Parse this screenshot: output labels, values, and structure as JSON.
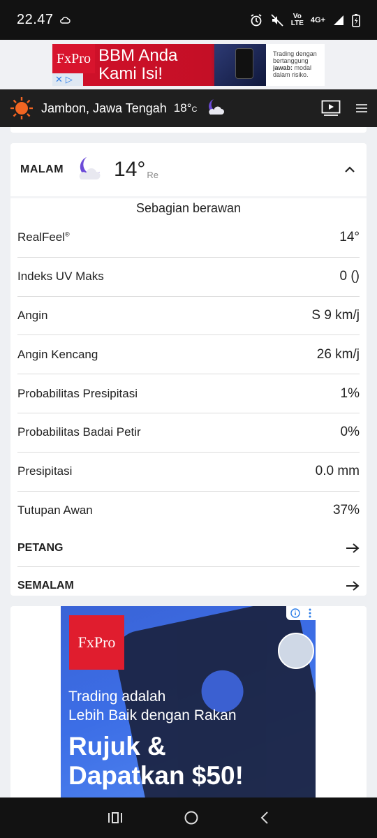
{
  "status_bar": {
    "time": "22.47",
    "network_top": "Vo",
    "network_bottom": "LTE",
    "network_type": "4G+",
    "icons": [
      "cloud-icon",
      "alarm-icon",
      "mute-icon",
      "signal-icon",
      "battery-icon"
    ]
  },
  "top_ad": {
    "logo": "FxPro",
    "headline_line1": "BBM Anda",
    "headline_line2": "Kami Isi!",
    "small_line1": "Trading dengan",
    "small_line2": "bertanggung",
    "small_line3": "jawab:",
    "small_line4": "modal",
    "small_line5": "dalam risiko."
  },
  "header": {
    "location": "Jambon, Jawa Tengah",
    "temp": "18°",
    "temp_unit": "C"
  },
  "night_card": {
    "period": "MALAM",
    "temp": "14°",
    "temp_unit": "Re",
    "phrase": "Sebagian berawan",
    "details": [
      {
        "label": "RealFeel",
        "value": "14°"
      },
      {
        "label": "Indeks UV Maks",
        "value": "0 ()"
      },
      {
        "label": "Angin",
        "value": "S 9 km/j"
      },
      {
        "label": "Angin Kencang",
        "value": "26 km/j"
      },
      {
        "label": "Probabilitas Presipitasi",
        "value": "1%"
      },
      {
        "label": "Probabilitas Badai Petir",
        "value": "0%"
      },
      {
        "label": "Presipitasi",
        "value": "0.0 mm"
      },
      {
        "label": "Tutupan Awan",
        "value": "37%"
      }
    ],
    "links": [
      {
        "label": "PETANG"
      },
      {
        "label": "SEMALAM"
      }
    ]
  },
  "bottom_ad": {
    "logo": "FxPro",
    "line1": "Trading adalah",
    "line2": "Lebih Baik dengan Rakan",
    "line3": "Rujuk &",
    "line4": "Dapatkan $50!"
  },
  "colors": {
    "header_bg": "#1f1f1f",
    "accent_sun": "#f26522",
    "ad_red": "#d8142d",
    "ad_blue": "#3c6ee6"
  }
}
